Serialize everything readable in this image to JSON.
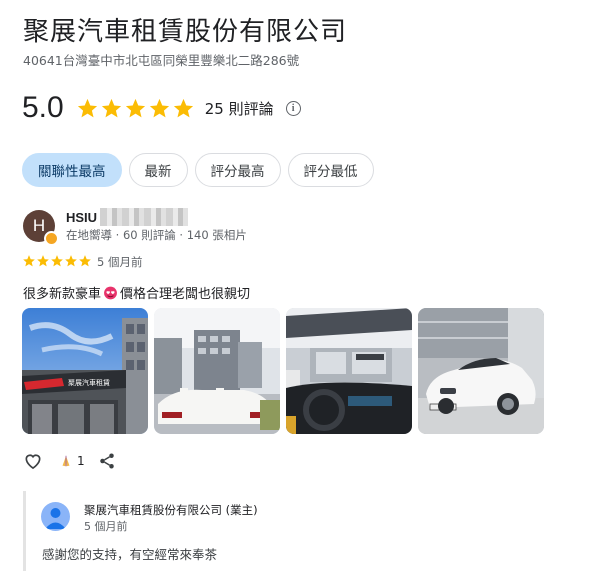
{
  "business": {
    "name": "聚展汽車租賃股份有限公司",
    "address": "40641台灣臺中市北屯區同榮里豐樂北二路286號"
  },
  "rating": {
    "value": "5.0",
    "stars": 5,
    "review_count": "25 則評論",
    "info_icon": "info-icon"
  },
  "sort_chips": [
    {
      "label": "關聯性最高",
      "active": true
    },
    {
      "label": "最新",
      "active": false
    },
    {
      "label": "評分最高",
      "active": false
    },
    {
      "label": "評分最低",
      "active": false
    }
  ],
  "review": {
    "avatar_letter": "H",
    "reviewer_name": "HSIU",
    "reviewer_meta": "在地嚮導 · 60 則評論 · 140 張相片",
    "stars": 5,
    "time": "5 個月前",
    "text_before_emoji": "很多新款豪車",
    "emoji": "smiling-face-with-heart-eyes",
    "text_after_emoji": "價格合理老闆也很親切",
    "photo_sign_text": "聚展汽車租賃",
    "photos": [
      "showroom-exterior-photo",
      "white-convertible-rear-photo",
      "convertible-interior-photo",
      "white-bmw-z4-photo"
    ],
    "like_count": "1"
  },
  "owner_reply": {
    "name": "聚展汽車租賃股份有限公司 (業主)",
    "time": "5 個月前",
    "text": "感謝您的支持，有空經常來奉茶"
  },
  "colors": {
    "star": "#fbbc04",
    "chip_active_bg": "#c2e0fb",
    "avatar_bg": "#5d4037",
    "owner_avatar_bg": "#8ab4f8"
  }
}
